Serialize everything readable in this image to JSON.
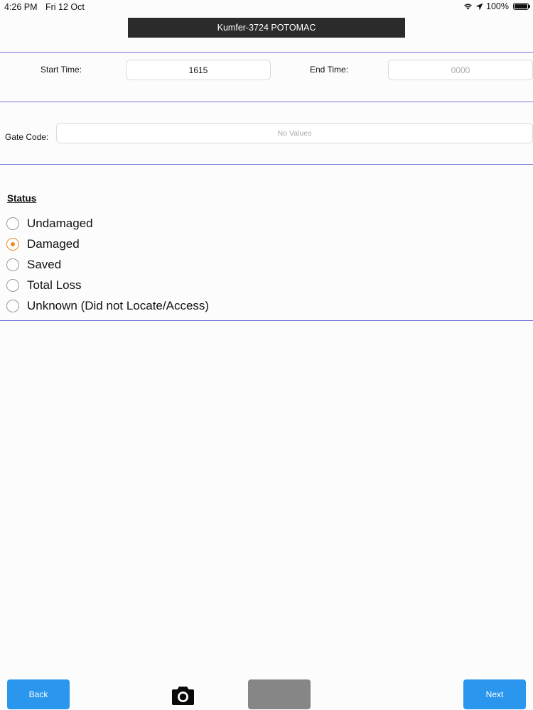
{
  "status_bar": {
    "time": "4:26 PM",
    "date": "Fri 12 Oct",
    "battery": "100%",
    "icons": [
      "wifi-icon",
      "location-arrow-icon",
      "battery-icon"
    ]
  },
  "header": {
    "title": "Kumfer-3724 POTOMAC"
  },
  "times": {
    "start_label": "Start Time:",
    "start_value": "1615",
    "end_label": "End Time:",
    "end_placeholder": "0000"
  },
  "gate": {
    "label": "Gate Code:",
    "placeholder": "No Values"
  },
  "status": {
    "heading": "Status",
    "options": [
      {
        "label": "Undamaged",
        "selected": false
      },
      {
        "label": "Damaged",
        "selected": true
      },
      {
        "label": "Saved",
        "selected": false
      },
      {
        "label": "Total Loss",
        "selected": false
      },
      {
        "label": "Unknown (Did not Locate/Access)",
        "selected": false
      }
    ]
  },
  "footer": {
    "back_label": "Back",
    "camera_icon": "camera-icon",
    "next_label": "Next"
  },
  "colors": {
    "accent": "#2a96ee",
    "selected_radio": "#f08a24",
    "divider": "#7777d9",
    "title_bar": "#2b2b2b"
  }
}
